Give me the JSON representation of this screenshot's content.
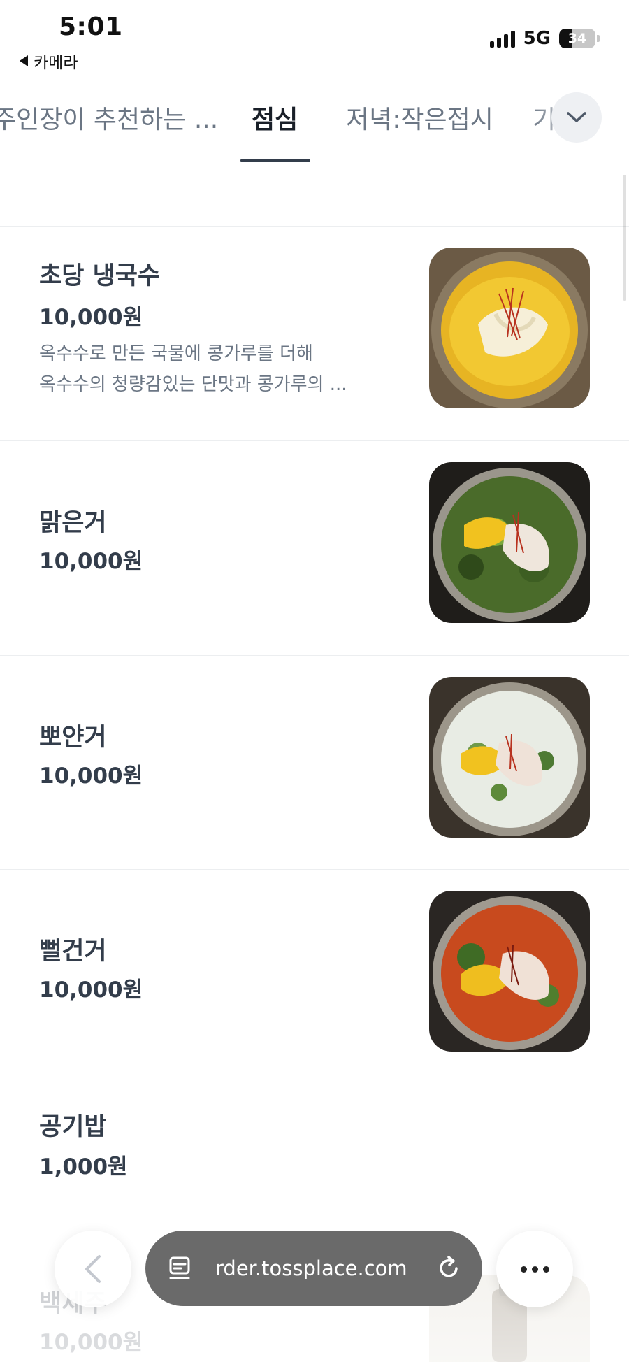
{
  "status_bar": {
    "time": "5:01",
    "back_app": "카메라",
    "network": "5G",
    "battery_percent": 34,
    "battery_label": "34"
  },
  "tabs": {
    "items": [
      {
        "label": "주인장이 추천하는 ..."
      },
      {
        "label": "점심",
        "active": true
      },
      {
        "label": "저녁:작은접시"
      },
      {
        "label": "기"
      }
    ],
    "expand_icon": "chevron-down-icon"
  },
  "menu": {
    "items": [
      {
        "name": "초당 냉국수",
        "price": "10,000원",
        "description_lines": [
          "옥수수로 만든 국물에 콩가루를 더해",
          "옥수수의 청량감있는 단맛과 콩가루의 ..."
        ],
        "image": "corn-cold-noodle-photo"
      },
      {
        "name": "맑은거",
        "price": "10,000원",
        "image": "clear-broth-noodle-photo"
      },
      {
        "name": "뽀얀거",
        "price": "10,000원",
        "image": "milky-broth-noodle-photo"
      },
      {
        "name": "뻘건거",
        "price": "10,000원",
        "image": "red-spicy-noodle-photo"
      },
      {
        "name": "공기밥",
        "price": "1,000원"
      },
      {
        "name": "백세주",
        "price": "10,000원",
        "image": "bottle-photo"
      }
    ]
  },
  "browser": {
    "url": "order.tossplace.com",
    "url_visible": "rder.tossplace.com",
    "colors": {
      "pill": "#6a6a6a",
      "accent_text": "#333d4b"
    }
  }
}
